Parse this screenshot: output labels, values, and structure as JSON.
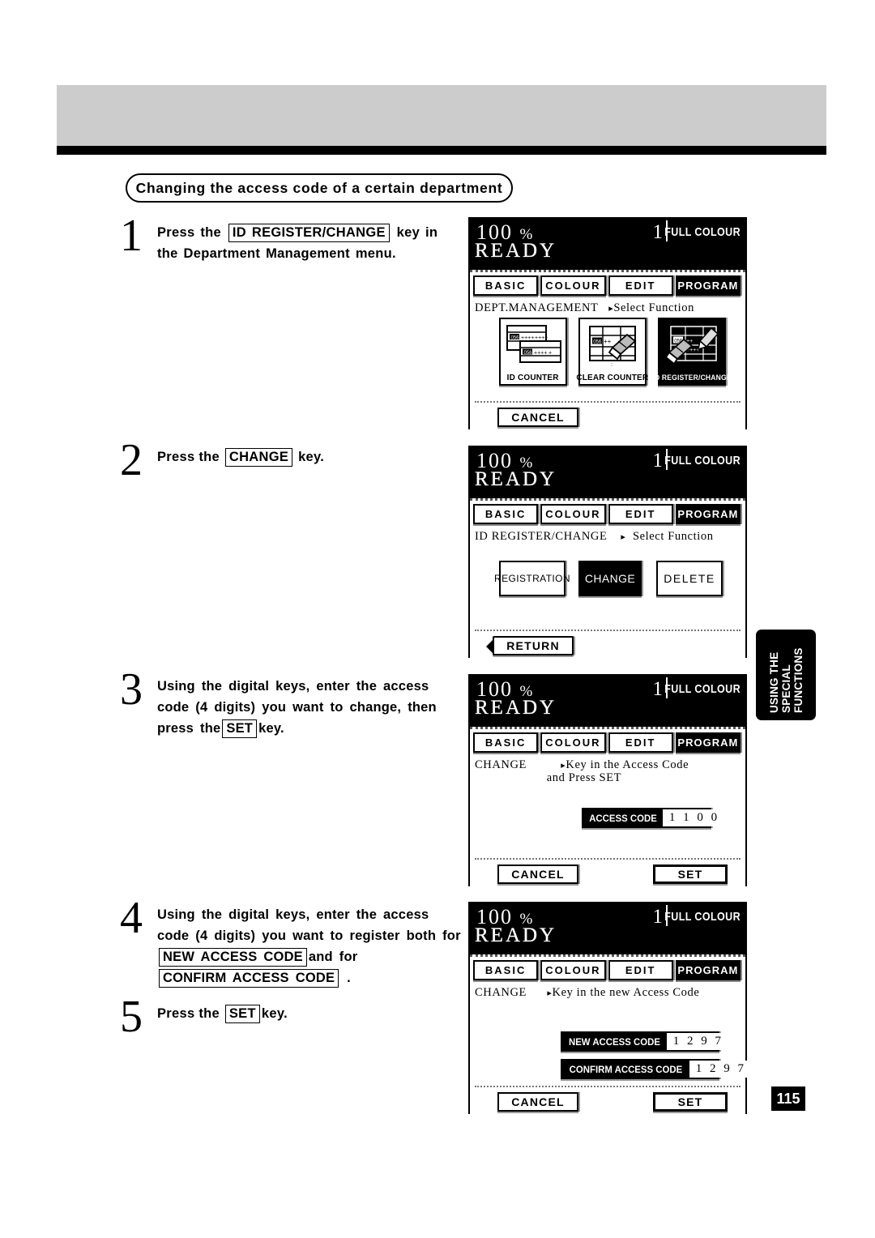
{
  "page": {
    "section_title": "Changing the access code of a certain department",
    "page_number": "115",
    "side_tab_lines": [
      "USING THE",
      "SPECIAL",
      "FUNCTIONS"
    ]
  },
  "steps": [
    {
      "number": "1",
      "parts": [
        {
          "t": "text",
          "v": "Press the "
        },
        {
          "t": "key",
          "v": "ID REGISTER/CHANGE"
        },
        {
          "t": "text",
          "v": " key in the Department Management menu."
        }
      ]
    },
    {
      "number": "2",
      "parts": [
        {
          "t": "text",
          "v": "Press the "
        },
        {
          "t": "key",
          "v": "CHANGE"
        },
        {
          "t": "text",
          "v": " key."
        }
      ]
    },
    {
      "number": "3",
      "parts": [
        {
          "t": "text",
          "v": "Using the digital keys, enter the access code (4 digits) you want to change, then press the"
        },
        {
          "t": "key",
          "v": "SET"
        },
        {
          "t": "text",
          "v": "key."
        }
      ]
    },
    {
      "number": "4",
      "parts": [
        {
          "t": "text",
          "v": "Using the digital keys, enter the access code (4 digits) you want to register both for "
        },
        {
          "t": "key",
          "v": "NEW ACCESS CODE"
        },
        {
          "t": "text",
          "v": "and for "
        },
        {
          "t": "key",
          "v": "CONFIRM ACCESS CODE"
        },
        {
          "t": "text",
          "v": " ."
        }
      ]
    },
    {
      "number": "5",
      "parts": [
        {
          "t": "text",
          "v": "Press the "
        },
        {
          "t": "key",
          "v": "SET"
        },
        {
          "t": "text",
          "v": "key."
        }
      ]
    }
  ],
  "status_bar": {
    "zoom": "100",
    "percent": "%",
    "copy_count": "1",
    "colour_mode": "FULL COLOUR",
    "ready": "READY"
  },
  "tabs": [
    {
      "label": "BASIC",
      "active": false
    },
    {
      "label": "COLOUR",
      "active": false
    },
    {
      "label": "EDIT",
      "active": false
    },
    {
      "label": "PROGRAM",
      "active": true
    }
  ],
  "panels": {
    "panel1": {
      "title": "DEPT.MANAGEMENT",
      "arrow": "▸",
      "prompt": "Select Function",
      "icon_buttons": [
        {
          "label": "ID COUNTER",
          "icon": "id-counter-icon",
          "selected": false
        },
        {
          "label": "CLEAR COUNTER",
          "icon": "clear-counter-icon",
          "selected": false
        },
        {
          "label": "ID REGISTER/CHANGE",
          "icon": "id-register-change-icon",
          "selected": true
        }
      ],
      "cancel_label": "CANCEL"
    },
    "panel2": {
      "title": "ID REGISTER/CHANGE",
      "arrow": "▸",
      "prompt": "Select Function",
      "buttons": [
        {
          "label": "REGISTRATION",
          "selected": false
        },
        {
          "label": "CHANGE",
          "selected": true
        },
        {
          "label": "DELETE",
          "selected": false
        }
      ],
      "return_label": "RETURN"
    },
    "panel3": {
      "title": "CHANGE",
      "arrow": "▸",
      "prompt_line1": "Key in the Access Code",
      "prompt_line2": "and Press SET",
      "field": {
        "label": "ACCESS CODE",
        "value": "1 1 0 0"
      },
      "cancel_label": "CANCEL",
      "set_label": "SET"
    },
    "panel4": {
      "title": "CHANGE",
      "arrow": "▸",
      "prompt_line1": "Key in the new Access Code",
      "fields": [
        {
          "label": "NEW ACCESS CODE",
          "value": "1 2 9 7"
        },
        {
          "label": "CONFIRM ACCESS CODE",
          "value": "1 2 9 7"
        }
      ],
      "cancel_label": "CANCEL",
      "set_label": "SET"
    }
  }
}
